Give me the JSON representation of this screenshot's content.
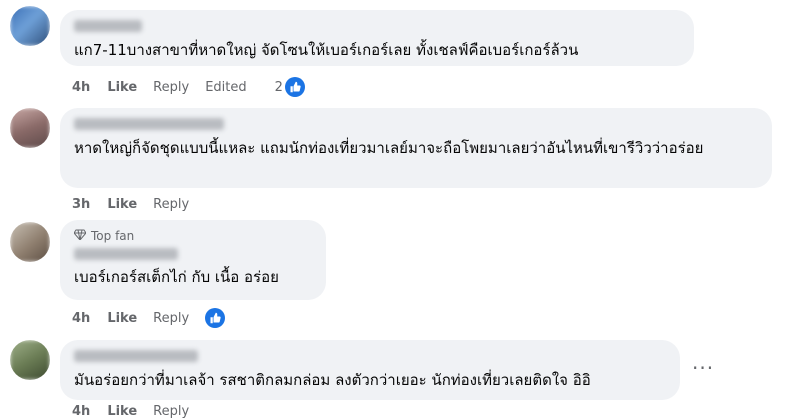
{
  "comments": [
    {
      "text": "แก7-11บางสาขาที่หาดใหญ่ จัดโซนให้เบอร์เกอร์เลย ทั้งเชลฟ์คือเบอร์เกอร์ล้วน",
      "time": "4h",
      "like_label": "Like",
      "reply_label": "Reply",
      "edited_label": "Edited",
      "reaction_count": "2"
    },
    {
      "text": "หาดใหญ่ก็จัดชุดแบบนี้แหละ แถมนักท่องเที่ยวมาเลย์มาจะถือโพยมาเลยว่าอันไหนที่เขารีวิวว่าอร่อย",
      "time": "3h",
      "like_label": "Like",
      "reply_label": "Reply"
    },
    {
      "badge": "Top fan",
      "text": "เบอร์เกอร์สเต็กไก่ กับ เนื้อ อร่อย",
      "time": "4h",
      "like_label": "Like",
      "reply_label": "Reply"
    },
    {
      "text": "มันอร่อยกว่าที่มาเลจ้า รสชาติกลมกล่อม ลงตัวกว่าเยอะ นักท่องเที่ยวเลยติดใจ อิอิ",
      "time": "4h",
      "like_label": "Like",
      "reply_label": "Reply",
      "more_label": "···"
    }
  ],
  "colors": {
    "bubble": "#f0f2f5",
    "meta_text": "#65676b",
    "like_blue": "#1b74e4"
  },
  "icons": {
    "reaction": "thumbs-up-icon",
    "badge": "diamond-icon",
    "more": "more-options-icon"
  }
}
